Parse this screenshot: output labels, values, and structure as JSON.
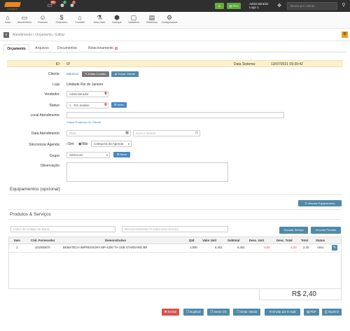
{
  "topbar": {
    "logo_text": "ADORAN",
    "badges": [
      "99+",
      "0",
      "0"
    ],
    "btn_green": "$",
    "btn_pdv": "PDV",
    "user_name": "Administrador",
    "user_logo": "Logo 1",
    "search_placeholder": "Busca por cliente"
  },
  "nav": [
    {
      "icon": "⌂",
      "label": "Início"
    },
    {
      "icon": "▭",
      "label": "Atendimento"
    },
    {
      "icon": "☺",
      "label": "Pessoas"
    },
    {
      "icon": "$",
      "label": "Financeiro"
    },
    {
      "icon": "⌂",
      "label": "Contábil"
    },
    {
      "icon": "⚗",
      "label": "Help Desk"
    },
    {
      "icon": "⬢",
      "label": "Estoque"
    },
    {
      "icon": "▢",
      "label": "Cadastros"
    },
    {
      "icon": "▤",
      "label": "Relatórios"
    },
    {
      "icon": "⚙",
      "label": "Configurações"
    }
  ],
  "breadcrumb": "Atendimento  /  Orçamento  /  Editar",
  "tabs": [
    {
      "label": "Orçamento"
    },
    {
      "label": "Arquivos"
    },
    {
      "label": "Documentos"
    },
    {
      "label": "Relacionamento",
      "count": "0"
    }
  ],
  "form": {
    "id_label": "ID:",
    "id_value": "97",
    "data_sistema_label": "Data Sistema:",
    "data_sistema_value": "13/07/2021 09:39:42",
    "cliente_label": "Cliente:",
    "cliente_value": "Maurício",
    "btn_editar_contato": "Editar Contato",
    "btn_trocar_cliente": "Trocar Cliente",
    "loja_label": "Loja:",
    "loja_value": "Unidade Rio de Janeiro",
    "vendedor_label": "Vendedor:",
    "vendedor_value": "Administrador",
    "status_label": "Status:",
    "status_value": "1 - Em analise",
    "btn_novo": "Novo",
    "local_label": "Local Atendimento:",
    "local_value": "",
    "copiar_endereco": "Copiar Endereço do Cliente",
    "data_atend_label": "Data Atendimento:",
    "data_placeholder": "Data",
    "hora_placeholder": "Hora e minuto",
    "sinc_label": "Sincronizar Agenda:",
    "sim": "Sim",
    "nao": "Não",
    "categoria_agenda": "Categoria da Agenda",
    "grupo_label": "Grupo:",
    "grupo_value": "Selecione",
    "obs_label": "Observação:"
  },
  "equipamentos": {
    "title": "Equipamentos (opcional)",
    "btn_vincular": "Vincular Equipamento"
  },
  "produtos": {
    "title": "Produtos & Serviços",
    "leitor_placeholder": "Leitor de Código de Barra",
    "buscar_placeholder": "Buscar/Adicionar Produto e/ou Serviço",
    "btn_vincular_servico": "Vincular Serviço",
    "btn_vincular_produto": "Vincular Produto",
    "columns": [
      "Item",
      "Cód. Fornecedor",
      "Demonstrativo",
      "Qtd",
      "Valor Unit",
      "Subtotal",
      "Desc. Unit",
      "Desc. Total",
      "Total",
      "Status"
    ],
    "rows": [
      {
        "item": "1",
        "cod": "101000870",
        "demo": "BEMATECH IMPRESSORA MP-4200 TH USB STARDARD BR",
        "qtd": "1,000",
        "valor": "6,401",
        "subtotal": "6,401",
        "desc_unit": "-4,00",
        "desc_total": "-4,00",
        "total": "2,40",
        "status": "Ativo"
      }
    ],
    "grand_total": "R$ 2,40"
  },
  "actions": [
    {
      "label": "Excluir",
      "icon": "✖",
      "color": "#d9534f"
    },
    {
      "label": "Duplicar",
      "icon": "❐",
      "color": "#508aa8"
    },
    {
      "label": "Gerar OS",
      "icon": "❐",
      "color": "#508aa8"
    },
    {
      "label": "Gerar Venda",
      "icon": "❐",
      "color": "#508aa8"
    },
    {
      "label": "Enviar por E-mail",
      "icon": "✉",
      "color": "#508aa8"
    },
    {
      "label": "PDF",
      "icon": "▤",
      "color": "#508aa8"
    },
    {
      "label": "Imprimir",
      "icon": "⎙",
      "color": "#508aa8"
    }
  ]
}
